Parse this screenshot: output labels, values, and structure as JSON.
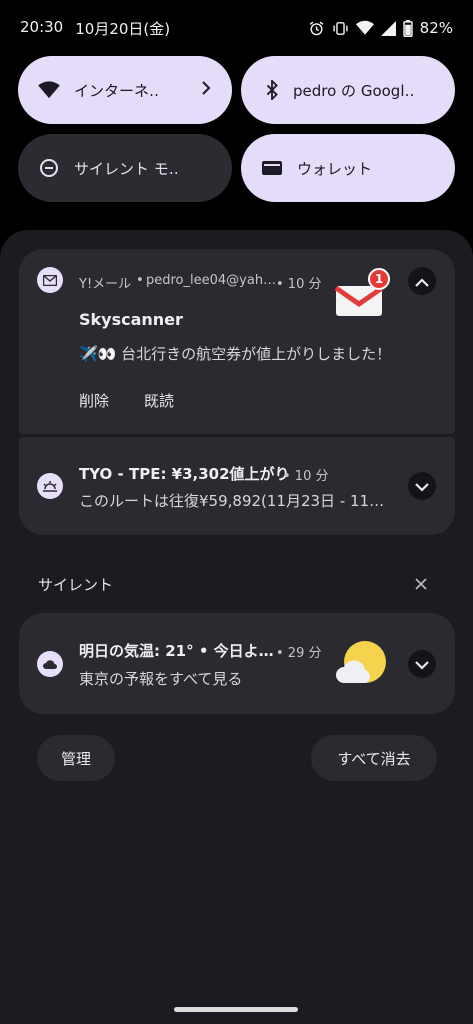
{
  "status": {
    "time": "20:30",
    "date": "10月20日(金)",
    "battery": "82%",
    "icons": [
      "alarm-icon",
      "vibrate-icon",
      "wifi-icon",
      "signal-icon",
      "battery-icon"
    ]
  },
  "quick_settings": {
    "tiles": [
      {
        "label": "インターネ‥",
        "icon": "wifi-icon",
        "active": true
      },
      {
        "label": "pedro の Googl‥",
        "icon": "bluetooth-icon",
        "active": true
      },
      {
        "label": "サイレント モ‥",
        "icon": "do-not-disturb-icon",
        "active": false
      },
      {
        "label": "ウォレット",
        "icon": "wallet-icon",
        "active": true
      }
    ]
  },
  "notifications": [
    {
      "app": "Y!メール",
      "account": "pedro_lee04@yah…",
      "time": "• 10 分",
      "title": "Skyscanner",
      "body": "✈️👀 台北行きの航空券が値上がりしました！",
      "badge": "1",
      "actions": [
        "削除",
        "既読"
      ]
    },
    {
      "title": "TYO - TPE: ¥3,302値上がり",
      "time": "• 10 分",
      "body": "このルートは往復¥59,892(11月23日 - 11…"
    }
  ],
  "silent_section": {
    "label": "サイレント"
  },
  "weather_notification": {
    "title": "明日の気温: 21° • 今日よ…",
    "time": "• 29 分",
    "body": "東京の予報をすべて見る"
  },
  "buttons": {
    "manage": "管理",
    "clear_all": "すべて消去"
  },
  "colors": {
    "tile_active": "#e4dcf8",
    "tile_inactive": "#2c2b32",
    "card": "#2b2a30",
    "shade": "#1c1b21"
  }
}
